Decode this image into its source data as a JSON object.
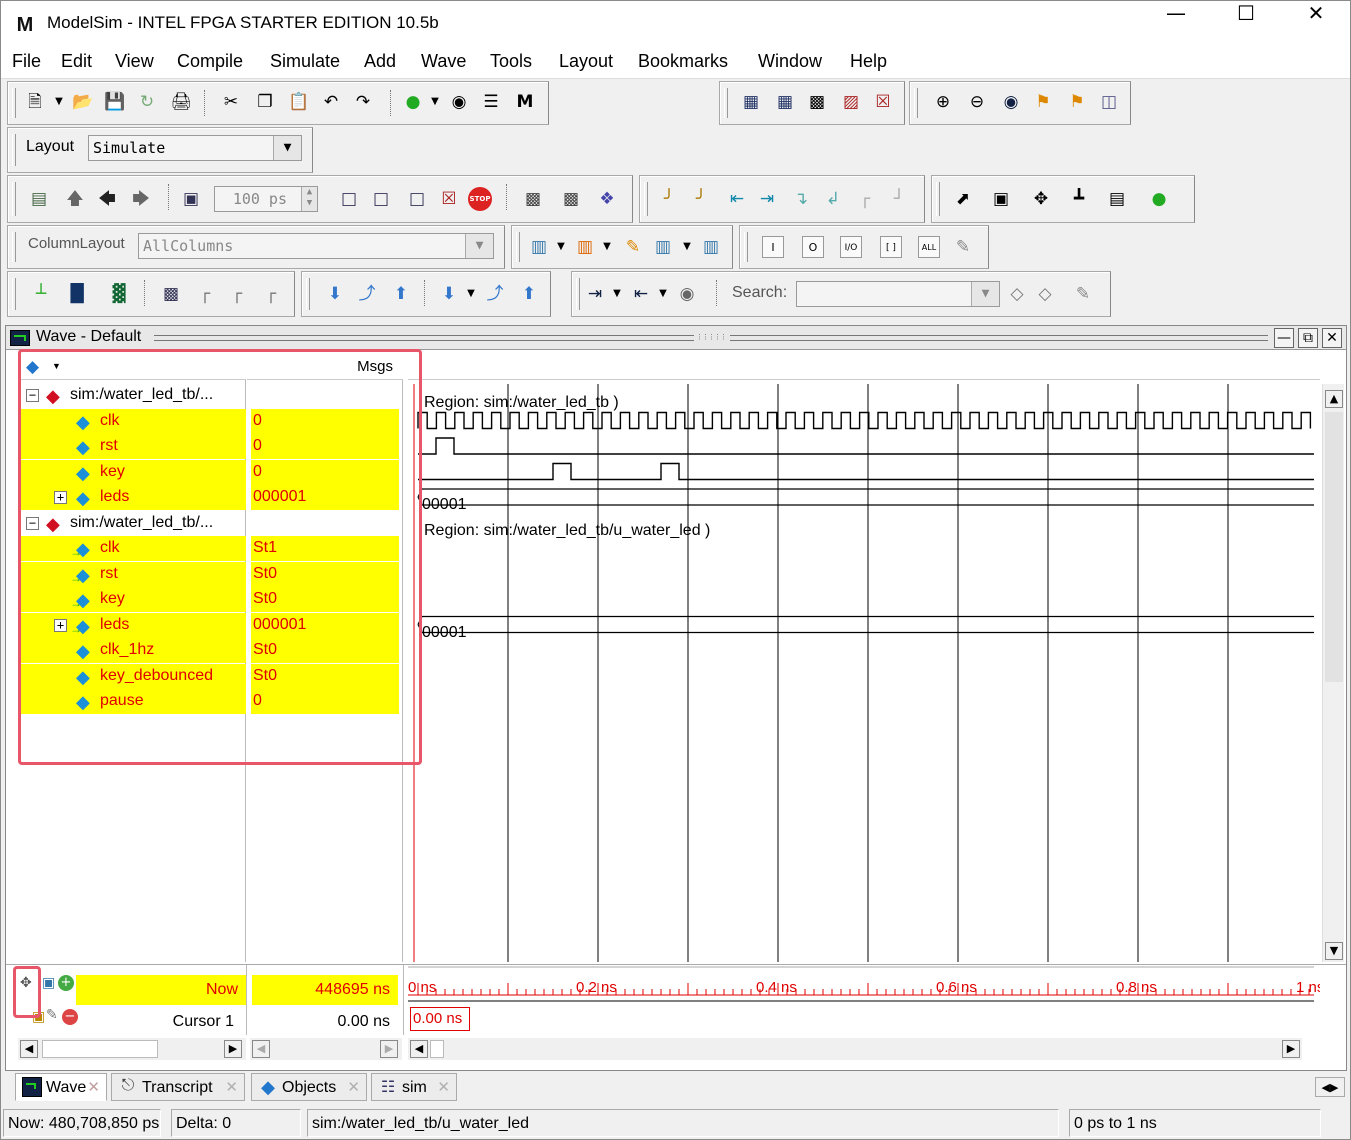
{
  "app": {
    "title": "ModelSim - INTEL FPGA STARTER EDITION 10.5b",
    "icon": "M"
  },
  "menu": [
    "File",
    "Edit",
    "View",
    "Compile",
    "Simulate",
    "Add",
    "Wave",
    "Tools",
    "Layout",
    "Bookmarks",
    "Window",
    "Help"
  ],
  "layout_bar": {
    "label": "Layout",
    "value": "Simulate"
  },
  "sim_bar": {
    "run_length": "100 ps"
  },
  "column_bar": {
    "label": "ColumnLayout",
    "value": "AllColumns"
  },
  "search_bar": {
    "label": "Search:",
    "value": ""
  },
  "toolbar_tiny_labels": {
    "i": "I",
    "o": "O",
    "io": "I/O",
    "bracket": "[ ]",
    "all": "ALL"
  },
  "wave": {
    "window_title": "Wave - Default",
    "msgs_header": "Msgs",
    "signals": [
      {
        "name": "sim:/water_led_tb/...",
        "value": "",
        "kind": "group",
        "indent": 0,
        "expander": "−"
      },
      {
        "name": "clk",
        "value": "0",
        "kind": "in",
        "indent": 1
      },
      {
        "name": "rst",
        "value": "0",
        "kind": "in",
        "indent": 1
      },
      {
        "name": "key",
        "value": "0",
        "kind": "in",
        "indent": 1
      },
      {
        "name": "leds",
        "value": "000001",
        "kind": "in",
        "indent": 1,
        "expander": "+"
      },
      {
        "name": "sim:/water_led_tb/...",
        "value": "",
        "kind": "group",
        "indent": 0,
        "expander": "−"
      },
      {
        "name": "clk",
        "value": "St1",
        "kind": "port",
        "indent": 1
      },
      {
        "name": "rst",
        "value": "St0",
        "kind": "port",
        "indent": 1
      },
      {
        "name": "key",
        "value": "St0",
        "kind": "port",
        "indent": 1
      },
      {
        "name": "leds",
        "value": "000001",
        "kind": "port",
        "indent": 1,
        "expander": "+"
      },
      {
        "name": "clk_1hz",
        "value": "St0",
        "kind": "in",
        "indent": 1
      },
      {
        "name": "key_debounced",
        "value": "St0",
        "kind": "in",
        "indent": 1
      },
      {
        "name": "pause",
        "value": "0",
        "kind": "in",
        "indent": 1
      }
    ],
    "region1": "Region: sim:/water_led_tb )",
    "region2": "Region: sim:/water_led_tb/u_water_led )",
    "bus1_value": "00001",
    "bus2_value": "00001",
    "now_label": "Now",
    "now_value": "448695 ns",
    "cursor_label": "Cursor 1",
    "cursor_value": "0.00 ns",
    "cursor_flag": "0.00 ns",
    "time_labels": [
      {
        "text": "0 ns",
        "t": 0
      },
      {
        "text": "0.2 ns",
        "t": 0.2
      },
      {
        "text": "0.4 ns",
        "t": 0.4
      },
      {
        "text": "0.6 ns",
        "t": 0.6
      },
      {
        "text": "0.8 ns",
        "t": 0.8
      },
      {
        "text": "1 ns",
        "t": 1.0
      }
    ]
  },
  "tabs": [
    {
      "label": "Wave",
      "icon": "wave-icon",
      "active": true
    },
    {
      "label": "Transcript",
      "icon": "transcript-icon"
    },
    {
      "label": "Objects",
      "icon": "objects-icon"
    },
    {
      "label": "sim",
      "icon": "sim-icon"
    }
  ],
  "status": {
    "now": "Now: 480,708,850 ps",
    "delta": "Delta: 0",
    "scope": "sim:/water_led_tb/u_water_led",
    "range": "0 ps to 1 ns"
  },
  "colors": {
    "highlight": "#ffff00",
    "signal_text": "#e00000",
    "wave": "#000000",
    "cursor": "#e00000",
    "annotation_box": "#e8566a"
  }
}
